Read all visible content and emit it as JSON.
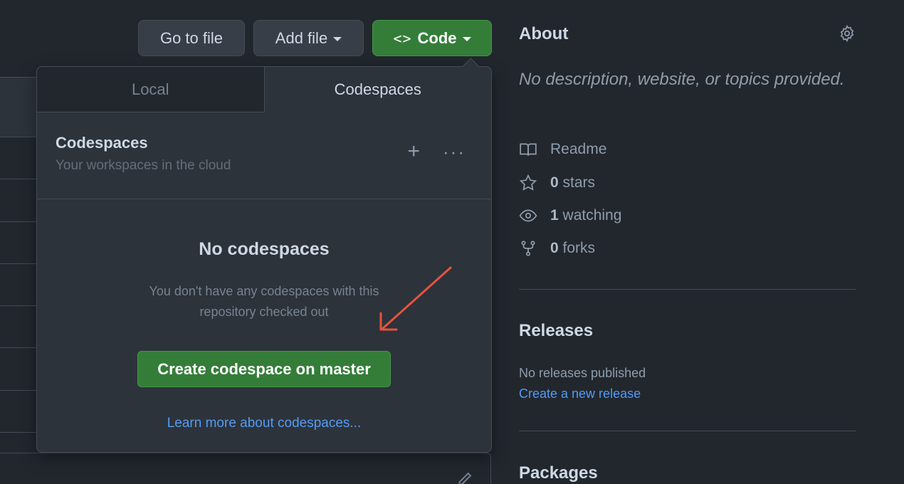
{
  "toolbar": {
    "goto_label": "Go to file",
    "add_label": "Add file",
    "code_glyph": "<>",
    "code_label": "Code"
  },
  "dropdown": {
    "tabs": [
      {
        "label": "Local",
        "active": false
      },
      {
        "label": "Codespaces",
        "active": true
      }
    ],
    "header_title": "Codespaces",
    "header_subtitle": "Your workspaces in the cloud",
    "plus_glyph": "+",
    "more_glyph": "···",
    "empty_title": "No codespaces",
    "empty_desc": "You don't have any codespaces with this repository checked out",
    "create_label": "Create codespace on master",
    "learn_label": "Learn more about codespaces..."
  },
  "sidebar": {
    "about_title": "About",
    "about_desc": "No description, website, or topics provided.",
    "readme_label": "Readme",
    "stars_count": "0",
    "stars_label": "stars",
    "watching_count": "1",
    "watching_label": "watching",
    "forks_count": "0",
    "forks_label": "forks",
    "releases_title": "Releases",
    "releases_none": "No releases published",
    "releases_link": "Create a new release",
    "packages_title": "Packages"
  },
  "colors": {
    "background": "#22272e",
    "primary_button": "#347d39",
    "link": "#539bf5",
    "annotation_arrow": "#e5533c"
  }
}
